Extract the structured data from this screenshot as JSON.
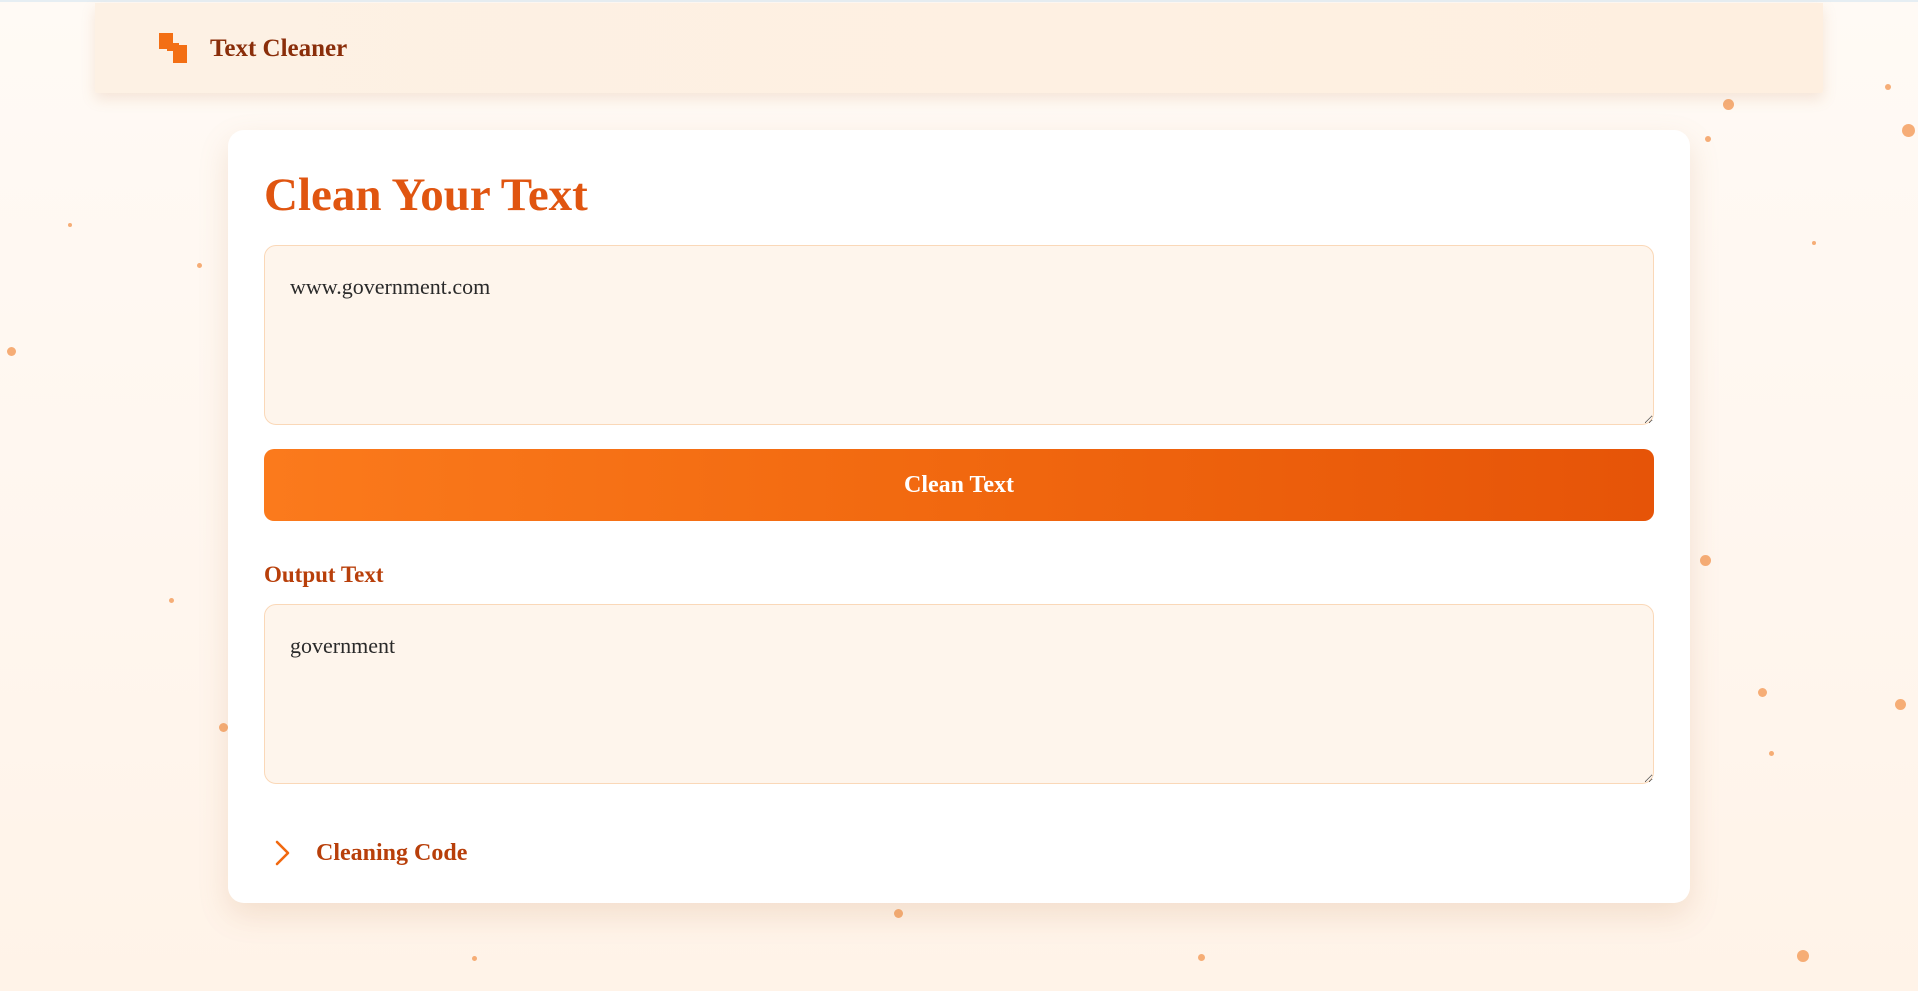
{
  "app": {
    "name": "Text Cleaner",
    "logo_icon": "logo-icon"
  },
  "main": {
    "title": "Clean Your Text",
    "input": {
      "value": "www.government.com"
    },
    "clean_button_label": "Clean Text",
    "output": {
      "label": "Output Text",
      "value": "government"
    },
    "code_section": {
      "label": "Cleaning Code",
      "icon": "chevron-right-icon",
      "expanded": false
    }
  },
  "colors": {
    "accent": "#f1680f",
    "title": "#e05510",
    "brand_text": "#8a2e0a",
    "label_text": "#b83f0a",
    "field_background": "#fef5ec"
  }
}
